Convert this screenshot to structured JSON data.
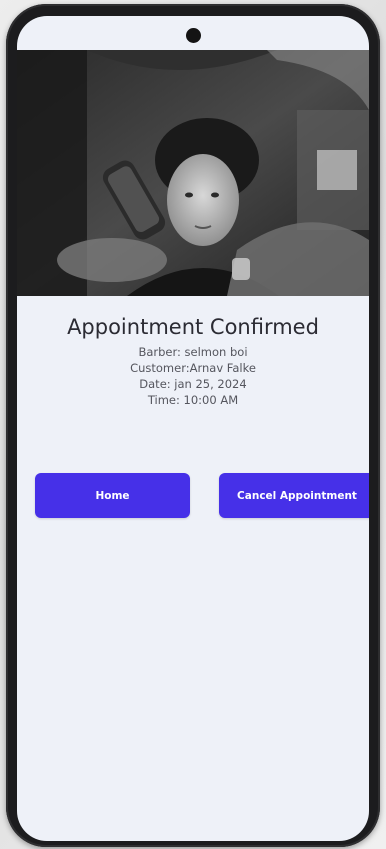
{
  "appointment": {
    "title": "Appointment Confirmed",
    "barber": "Barber: selmon boi",
    "customer": "Customer:Arnav Falke",
    "date": "Date: jan 25, 2024",
    "time": "Time: 10:00 AM"
  },
  "actions": {
    "home_label": "Home",
    "cancel_label": "Cancel Appointment"
  },
  "colors": {
    "primary": "#4630e8",
    "screen_background": "#eef1f8"
  }
}
